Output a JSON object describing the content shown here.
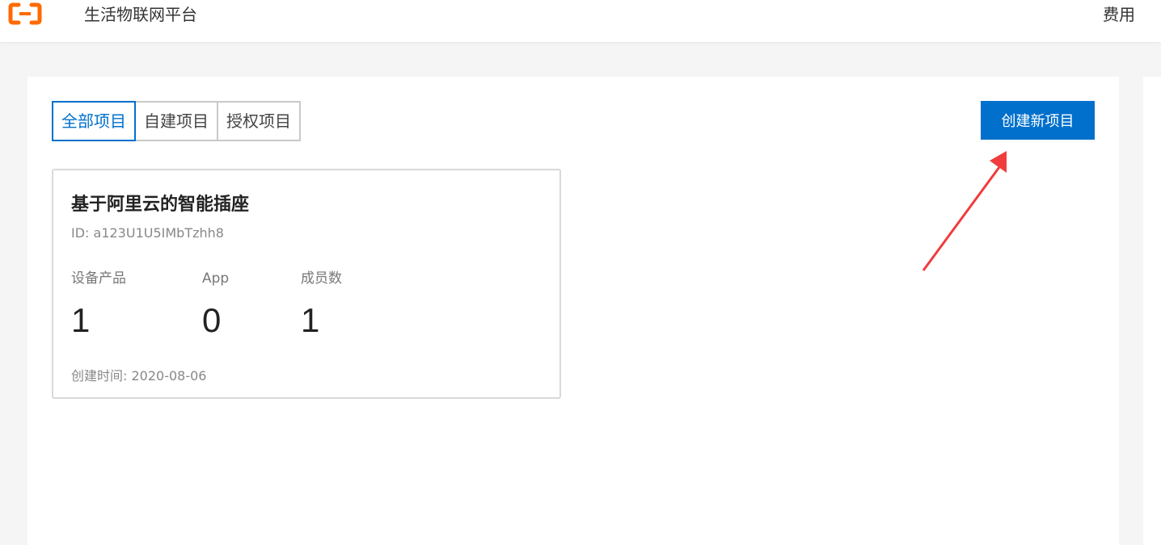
{
  "header": {
    "app_title": "生活物联网平台",
    "fee_label": "费用",
    "logo_icon": "aliyun-logo-icon",
    "logo_color": "#ff6a00"
  },
  "tabs": [
    {
      "label": "全部项目",
      "active": true
    },
    {
      "label": "自建项目",
      "active": false
    },
    {
      "label": "授权项目",
      "active": false
    }
  ],
  "create_button": {
    "label": "创建新项目",
    "color": "#0070cc"
  },
  "project_card": {
    "title": "基于阿里云的智能插座",
    "id_text": "ID: a123U1U5IMbTzhh8",
    "stats": [
      {
        "label": "设备产品",
        "value": "1"
      },
      {
        "label": "App",
        "value": "0"
      },
      {
        "label": "成员数",
        "value": "1"
      }
    ],
    "created_text": "创建时间: 2020-08-06"
  },
  "annotation": {
    "arrow_color": "#f03c3c",
    "icon": "red-arrow-annotation"
  }
}
